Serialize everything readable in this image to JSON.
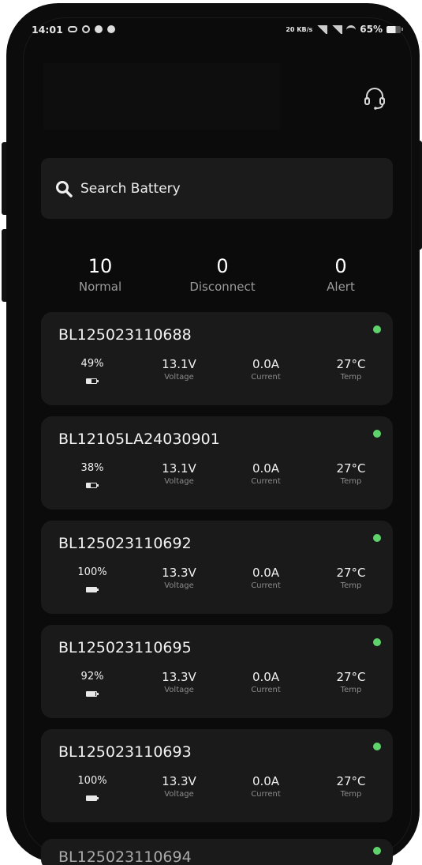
{
  "status_bar": {
    "time": "14:01",
    "net_speed": "20 KB/s",
    "battery_percent": "65%"
  },
  "search": {
    "placeholder": "Search Battery",
    "icon": "search-icon"
  },
  "header": {
    "support_icon": "headset-icon"
  },
  "summary": {
    "normal_count": "10",
    "normal_label": "Normal",
    "disconnect_count": "0",
    "disconnect_label": "Disconnect",
    "alert_count": "0",
    "alert_label": "Alert"
  },
  "labels": {
    "voltage": "Voltage",
    "current": "Current",
    "temp": "Temp"
  },
  "batteries": [
    {
      "id": "BL125023110688",
      "charge": "49%",
      "charge_level": 0.49,
      "voltage": "13.1V",
      "current": "0.0A",
      "temp": "27°C",
      "status_color": "#5fd36b"
    },
    {
      "id": "BL12105LA24030901",
      "charge": "38%",
      "charge_level": 0.38,
      "voltage": "13.1V",
      "current": "0.0A",
      "temp": "27°C",
      "status_color": "#5fd36b"
    },
    {
      "id": "BL125023110692",
      "charge": "100%",
      "charge_level": 1.0,
      "voltage": "13.3V",
      "current": "0.0A",
      "temp": "27°C",
      "status_color": "#5fd36b"
    },
    {
      "id": "BL125023110695",
      "charge": "92%",
      "charge_level": 0.92,
      "voltage": "13.3V",
      "current": "0.0A",
      "temp": "27°C",
      "status_color": "#5fd36b"
    },
    {
      "id": "BL125023110693",
      "charge": "100%",
      "charge_level": 1.0,
      "voltage": "13.3V",
      "current": "0.0A",
      "temp": "27°C",
      "status_color": "#5fd36b"
    }
  ],
  "peek_card": {
    "id": "BL125023110694"
  },
  "colors": {
    "background": "#0b0b0b",
    "card": "#1a1a1a",
    "status_ok": "#5fd36b"
  }
}
